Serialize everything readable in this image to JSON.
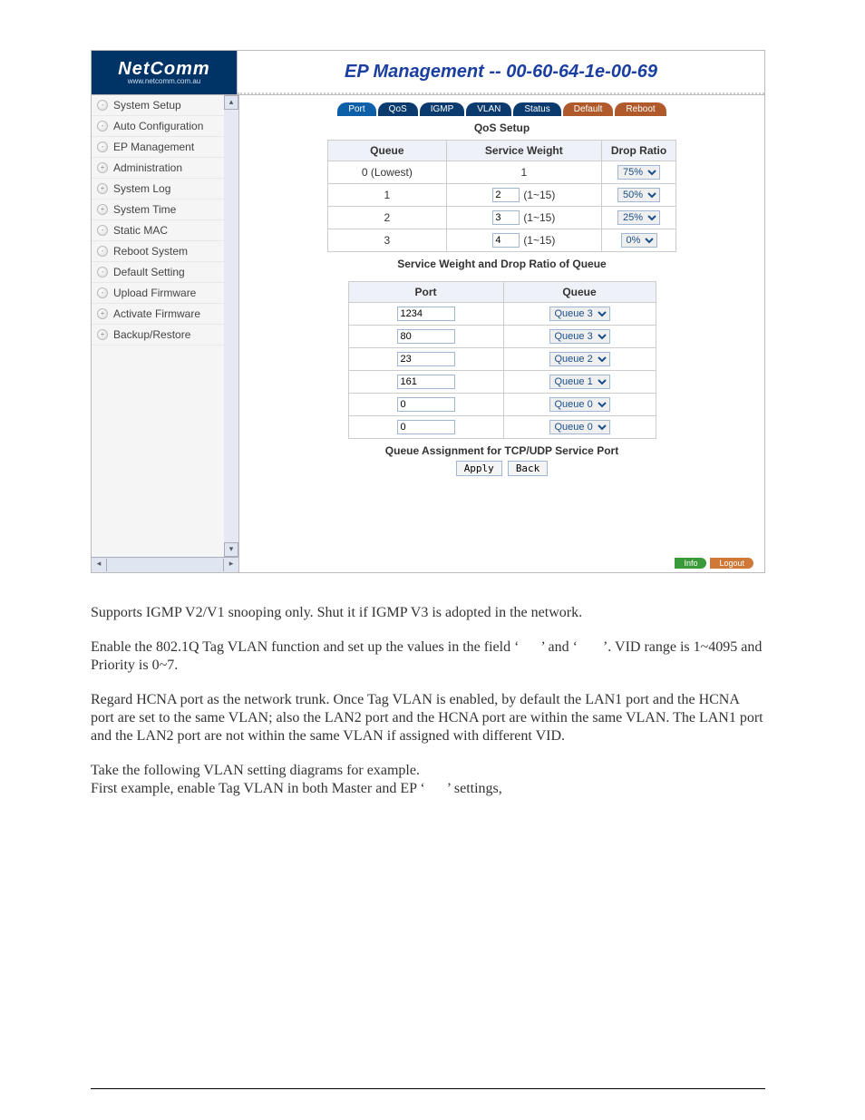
{
  "logo": {
    "main": "NetComm",
    "sub": "www.netcomm.com.au"
  },
  "title": "EP Management -- 00-60-64-1e-00-69",
  "tabs": [
    {
      "label": "Port",
      "kind": "active"
    },
    {
      "label": "QoS",
      "kind": ""
    },
    {
      "label": "IGMP",
      "kind": ""
    },
    {
      "label": "VLAN",
      "kind": ""
    },
    {
      "label": "Status",
      "kind": ""
    },
    {
      "label": "Default",
      "kind": "alt"
    },
    {
      "label": "Reboot",
      "kind": "alt"
    }
  ],
  "nav": [
    {
      "label": "System Setup",
      "sign": "-"
    },
    {
      "label": "Auto Configuration",
      "sign": "-"
    },
    {
      "label": "EP Management",
      "sign": "-"
    },
    {
      "label": "Administration",
      "sign": "+"
    },
    {
      "label": "System Log",
      "sign": "+"
    },
    {
      "label": "System Time",
      "sign": "+"
    },
    {
      "label": "Static MAC",
      "sign": "-"
    },
    {
      "label": "Reboot System",
      "sign": "-"
    },
    {
      "label": "Default Setting",
      "sign": "-"
    },
    {
      "label": "Upload Firmware",
      "sign": "-"
    },
    {
      "label": "Activate Firmware",
      "sign": "+"
    },
    {
      "label": "Backup/Restore",
      "sign": "+"
    }
  ],
  "qos": {
    "title": "QoS Setup",
    "headers": {
      "queue": "Queue",
      "sw": "Service Weight",
      "dr": "Drop Ratio"
    },
    "rows": [
      {
        "queue": "0 (Lowest)",
        "sw_val": "",
        "sw_text": "1",
        "hint": "",
        "drop": "75%"
      },
      {
        "queue": "1",
        "sw_val": "2",
        "sw_text": "",
        "hint": "(1~15)",
        "drop": "50%"
      },
      {
        "queue": "2",
        "sw_val": "3",
        "sw_text": "",
        "hint": "(1~15)",
        "drop": "25%"
      },
      {
        "queue": "3",
        "sw_val": "4",
        "sw_text": "",
        "hint": "(1~15)",
        "drop": "0%"
      }
    ],
    "caption1": "Service Weight and Drop Ratio of Queue"
  },
  "portqueue": {
    "headers": {
      "port": "Port",
      "queue": "Queue"
    },
    "rows": [
      {
        "port": "1234",
        "queue": "Queue 3"
      },
      {
        "port": "80",
        "queue": "Queue 3"
      },
      {
        "port": "23",
        "queue": "Queue 2"
      },
      {
        "port": "161",
        "queue": "Queue 1"
      },
      {
        "port": "0",
        "queue": "Queue 0"
      },
      {
        "port": "0",
        "queue": "Queue 0"
      }
    ],
    "caption2": "Queue Assignment for TCP/UDP Service Port"
  },
  "buttons": {
    "apply": "Apply",
    "back": "Back"
  },
  "footer": {
    "info": "Info",
    "logout": "Logout"
  },
  "doc": {
    "p1": "Supports IGMP V2/V1 snooping only. Shut it if IGMP V3 is adopted in the network.",
    "p2": "Enable the 802.1Q Tag VLAN function and set up the values in the field ‘      ’ and ‘       ’. VID range is 1~4095 and Priority is 0~7.",
    "p3": "Regard HCNA port as the network trunk. Once Tag VLAN is enabled, by default the LAN1 port and the HCNA port are set to the same VLAN; also the LAN2 port and the HCNA port are within the same VLAN. The LAN1 port and the LAN2 port are not within the same VLAN if assigned with different VID.",
    "p4": "Take the following VLAN setting diagrams for example.\nFirst example, enable Tag VLAN in both Master and EP ‘      ’ settings,"
  }
}
